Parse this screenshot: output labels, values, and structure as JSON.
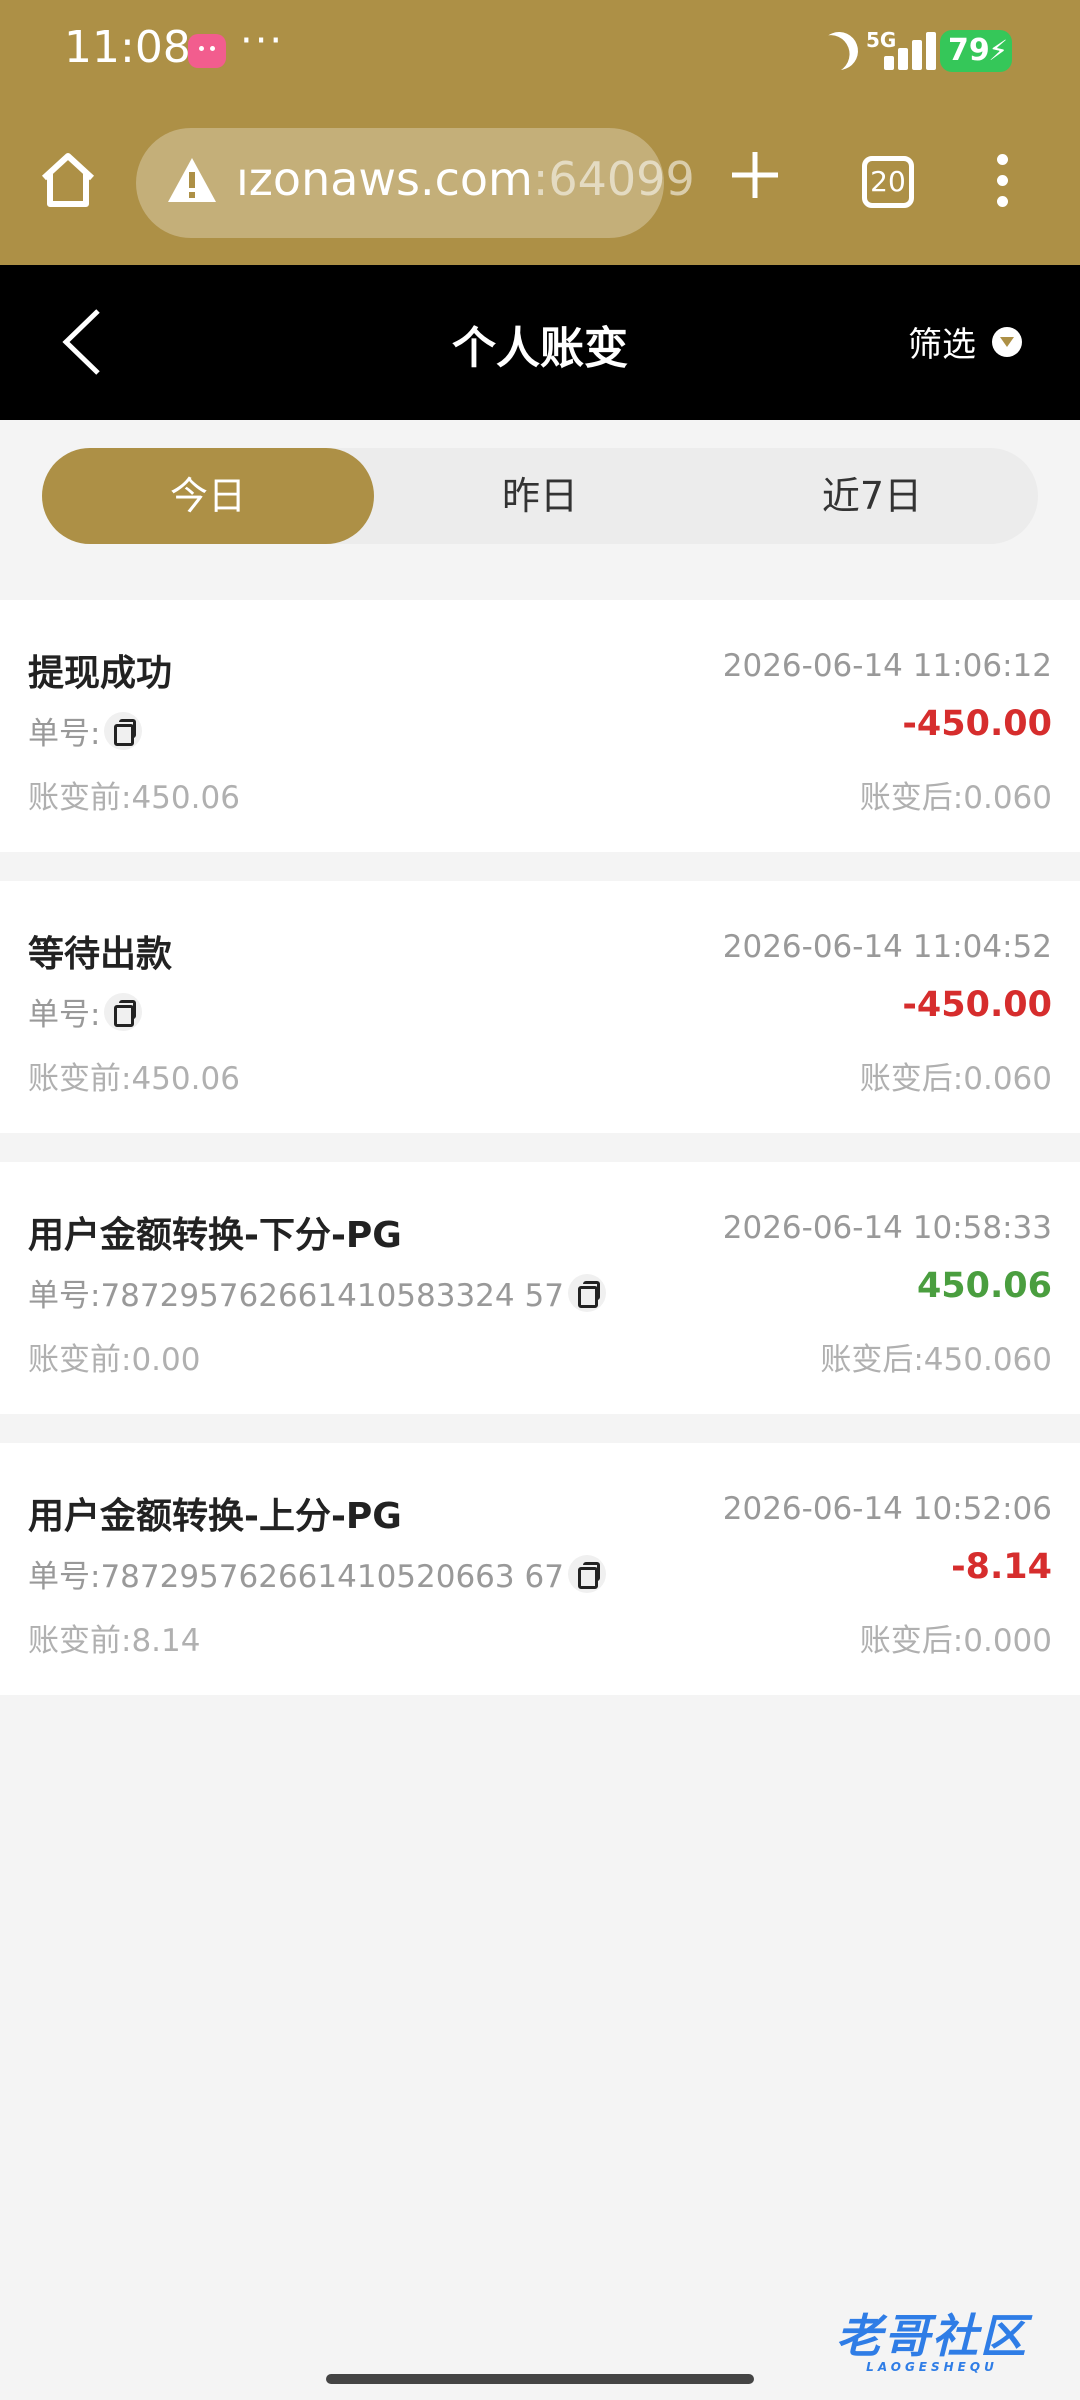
{
  "status_bar": {
    "time": "11:08",
    "dots": "···",
    "network": "5G",
    "battery": "79"
  },
  "browser": {
    "url": "ızonaws.com",
    "port": ":64099",
    "tab_count": "20"
  },
  "header": {
    "title": "个人账变",
    "filter_label": "筛选"
  },
  "tabs": [
    {
      "label": "今日",
      "active": true
    },
    {
      "label": "昨日",
      "active": false
    },
    {
      "label": "近7日",
      "active": false
    }
  ],
  "records": [
    {
      "title": "提现成功",
      "time": "2026-06-14 11:06:12",
      "order": "单号:",
      "amount": "-450.00",
      "type": "negative",
      "before": "账变前:450.06",
      "after": "账变后:0.060"
    },
    {
      "title": "等待出款",
      "time": "2026-06-14 11:04:52",
      "order": "单号:",
      "amount": "-450.00",
      "type": "negative",
      "before": "账变前:450.06",
      "after": "账变后:0.060"
    },
    {
      "title": "用户金额转换-下分-PG",
      "time": "2026-06-14 10:58:33",
      "order": "单号:787295762661410583324 57",
      "amount": "450.06",
      "type": "positive",
      "before": "账变前:0.00",
      "after": "账变后:450.060"
    },
    {
      "title": "用户金额转换-上分-PG",
      "time": "2026-06-14 10:52:06",
      "order": "单号:787295762661410520663 67",
      "amount": "-8.14",
      "type": "negative",
      "before": "账变前:8.14",
      "after": "账变后:0.000"
    }
  ],
  "watermark": {
    "text": "老哥社区",
    "sub": "LAOGESHEQU"
  },
  "colors": {
    "gold": "#ad9046",
    "negative": "#d62d2d",
    "positive": "#4a9e3f"
  }
}
